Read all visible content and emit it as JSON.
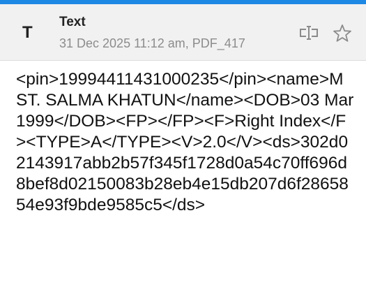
{
  "header": {
    "type_icon": "T",
    "title": "Text",
    "subtitle": "31 Dec 2025 11:12 am, PDF_417",
    "actions": [
      {
        "name": "edit-text-icon"
      },
      {
        "name": "star-icon"
      }
    ]
  },
  "content": {
    "text": "<pin>19994411431000235</pin><name>MST. SALMA KHATUN</name><DOB>03 Mar 1999</DOB><FP></FP><F>Right Index</F><TYPE>A</TYPE><V>2.0</V><ds>302d02143917abb2b57f345f1728d0a54c70ff696d8bef8d02150083b28eb4e15db207d6f2865854e93f9bde9585c5</ds>"
  },
  "colors": {
    "accent": "#1e88e5",
    "header_bg": "#f1f1f1",
    "icon_gray": "#8a8a8a"
  }
}
